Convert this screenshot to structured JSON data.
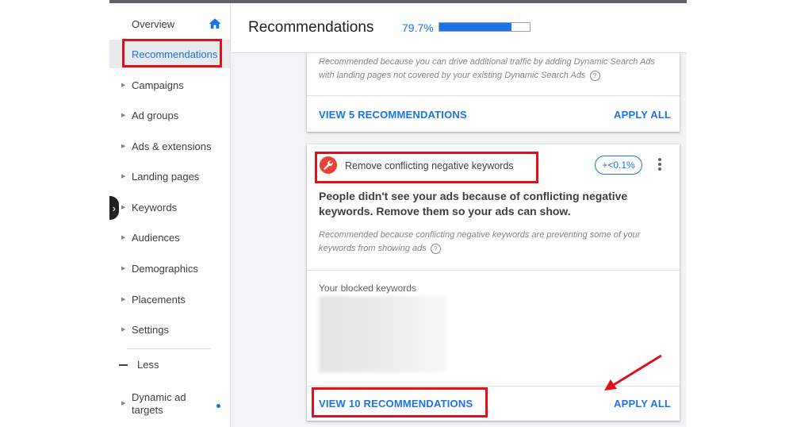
{
  "sidebar": {
    "items": [
      {
        "label": "Overview"
      },
      {
        "label": "Recommendations"
      },
      {
        "label": "Campaigns"
      },
      {
        "label": "Ad groups"
      },
      {
        "label": "Ads & extensions"
      },
      {
        "label": "Landing pages"
      },
      {
        "label": "Keywords"
      },
      {
        "label": "Audiences"
      },
      {
        "label": "Demographics"
      },
      {
        "label": "Placements"
      },
      {
        "label": "Settings"
      }
    ],
    "less_label": "Less",
    "dynamic_label": "Dynamic ad targets"
  },
  "header": {
    "title": "Recommendations",
    "optimization_score": "79.7%",
    "optimization_fraction": 0.797
  },
  "card1": {
    "reason": "Recommended because you can drive additional traffic by adding Dynamic Search Ads with landing pages not covered by your existing Dynamic Search Ads",
    "view_label": "VIEW 5 RECOMMENDATIONS",
    "apply_label": "APPLY ALL"
  },
  "card2": {
    "title": "Remove conflicting negative keywords",
    "impact": "+<0.1%",
    "headline": "People didn't see your ads because of conflicting negative keywords. Remove them so your ads can show.",
    "reason": "Recommended because conflicting negative keywords are preventing some of your keywords from showing ads",
    "blocked_label": "Your blocked keywords",
    "view_label": "VIEW 10 RECOMMENDATIONS",
    "apply_label": "APPLY ALL"
  },
  "colors": {
    "accent": "#1a73e8",
    "highlight": "#e0101a",
    "wrench": "#ea4335"
  },
  "icons": [
    "home-icon",
    "caret-right-icon",
    "wrench-icon",
    "more-vert-icon",
    "help-icon",
    "chevron-right-icon"
  ]
}
